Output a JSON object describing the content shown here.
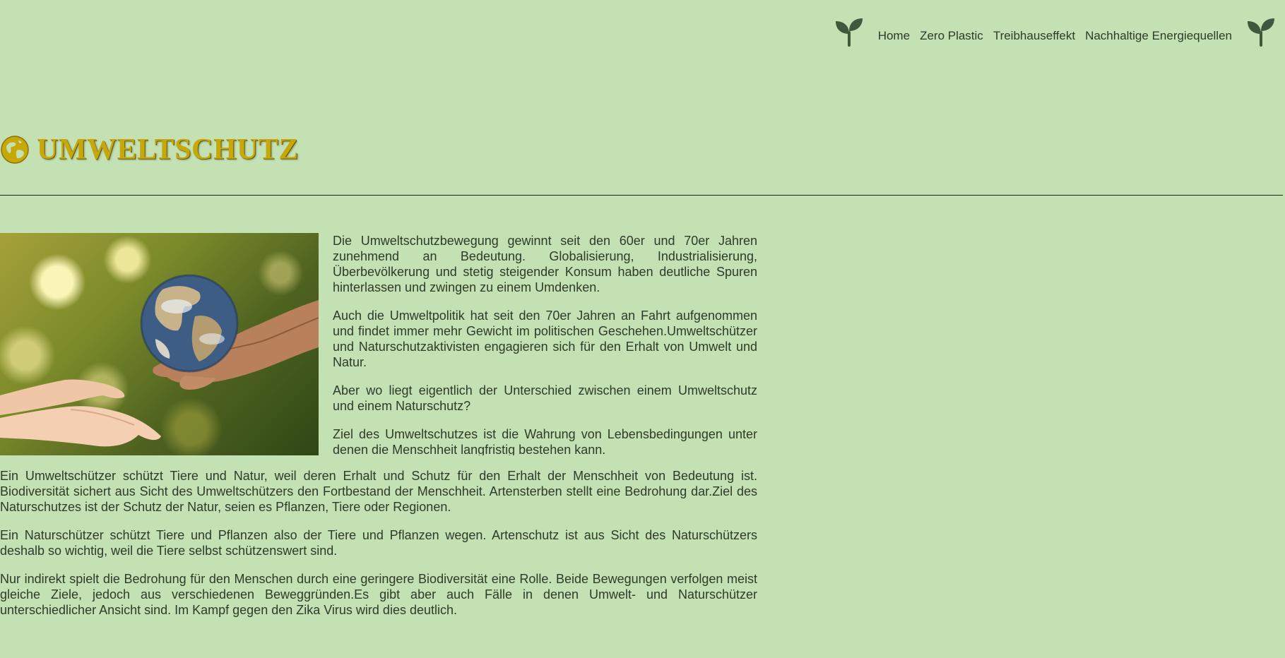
{
  "nav": {
    "items": [
      {
        "label": "Home"
      },
      {
        "label": "Zero Plastic"
      },
      {
        "label": "Treibhauseffekt"
      },
      {
        "label": "Nachhaltige Energiequellen"
      }
    ],
    "icon_left": "sprout-icon",
    "icon_right": "sprout-icon",
    "icon_color": "#3d5a3c"
  },
  "header": {
    "title": "UMWELTSCHUTZ",
    "icon": "globe-icon",
    "title_color": "#c7a80b"
  },
  "colors": {
    "background": "#c4e1b3",
    "text": "#2f3b2a"
  },
  "content": {
    "image_alt": "globe-in-hands",
    "beside_paragraphs": [
      "Die Umweltschutzbewegung gewinnt seit den 60er und 70er Jahren zunehmend an Bedeutung. Globalisierung, Industrialisierung, Überbevölkerung und stetig steigender Konsum haben deutliche Spuren hinterlassen und zwingen zu einem Umdenken.",
      "Auch die Umweltpolitik hat seit den 70er Jahren an Fahrt aufgenommen und findet immer mehr Gewicht im politischen Geschehen.Umweltschützer und Naturschutzaktivisten engagieren sich für den Erhalt von Umwelt und Natur.",
      "Aber wo liegt eigentlich der Unterschied zwischen einem Umweltschutz und einem Naturschutz?",
      "Ziel des Umweltschutzes ist die Wahrung von Lebensbedingungen unter denen die Menschheit langfristig bestehen kann."
    ],
    "below_paragraphs": [
      "Ein Umweltschützer schützt Tiere und Natur, weil deren Erhalt und Schutz für den Erhalt der Menschheit von Bedeutung ist. Biodiversität sichert aus Sicht des Umweltschützers den Fortbestand der Menschheit. Artensterben stellt eine Bedrohung dar.Ziel des Naturschutzes ist der Schutz der Natur, seien es Pflanzen, Tiere oder Regionen.",
      "Ein Naturschützer schützt Tiere und Pflanzen also der Tiere und Pflanzen wegen. Artenschutz ist aus Sicht des Naturschützers deshalb so wichtig, weil die Tiere selbst schützenswert sind.",
      "Nur indirekt spielt die Bedrohung für den Menschen durch eine geringere Biodiversität eine Rolle. Beide Bewegungen verfolgen meist gleiche Ziele, jedoch aus verschiedenen Beweggründen.Es gibt aber auch Fälle in denen Umwelt- und Naturschützer unterschiedlicher Ansicht sind. Im Kampf gegen den Zika Virus wird dies deutlich."
    ]
  }
}
